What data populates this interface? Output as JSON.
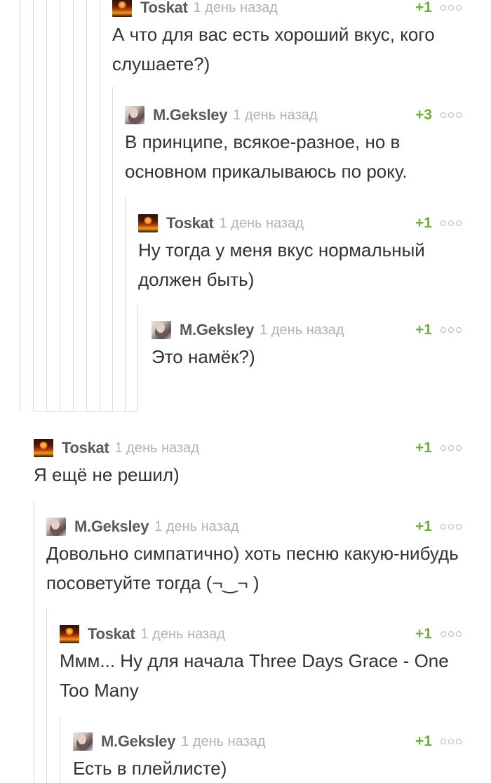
{
  "comments": [
    {
      "author": "Toskat",
      "time": "1 день назад",
      "rating": "+1",
      "text": "А что для вас есть хороший вкус, кого слушаете?)"
    },
    {
      "author": "M.Geksley",
      "time": "1 день назад",
      "rating": "+3",
      "text": "В принципе, всякое-разное, но в основном прикалываюсь по року."
    },
    {
      "author": "Toskat",
      "time": "1 день назад",
      "rating": "+1",
      "text": "Ну тогда у меня вкус нормальный должен быть)"
    },
    {
      "author": "M.Geksley",
      "time": "1 день назад",
      "rating": "+1",
      "text": "Это намёк?)"
    },
    {
      "author": "Toskat",
      "time": "1 день назад",
      "rating": "+1",
      "text": "Я ещё не решил)"
    },
    {
      "author": "M.Geksley",
      "time": "1 день назад",
      "rating": "+1",
      "text": "Довольно симпатично) хоть песню какую-нибудь посоветуйте тогда (¬‿¬ )"
    },
    {
      "author": "Toskat",
      "time": "1 день назад",
      "rating": "+1",
      "text": "Ммм... Ну для начала Three Days Grace - One Too Many"
    },
    {
      "author": "M.Geksley",
      "time": "1 день назад",
      "rating": "+1",
      "text": "Есть в плейлисте)"
    }
  ],
  "icons": {
    "avatar_toskat": "explosion-avatar",
    "avatar_geksley": "girl-photo-avatar",
    "menu": "three-dots-icon"
  },
  "colors": {
    "rating": "#6fae3a",
    "author": "#5a5a5a",
    "time": "#b3b3b3",
    "text": "#333333",
    "thread_line": "#d9d9d9"
  }
}
